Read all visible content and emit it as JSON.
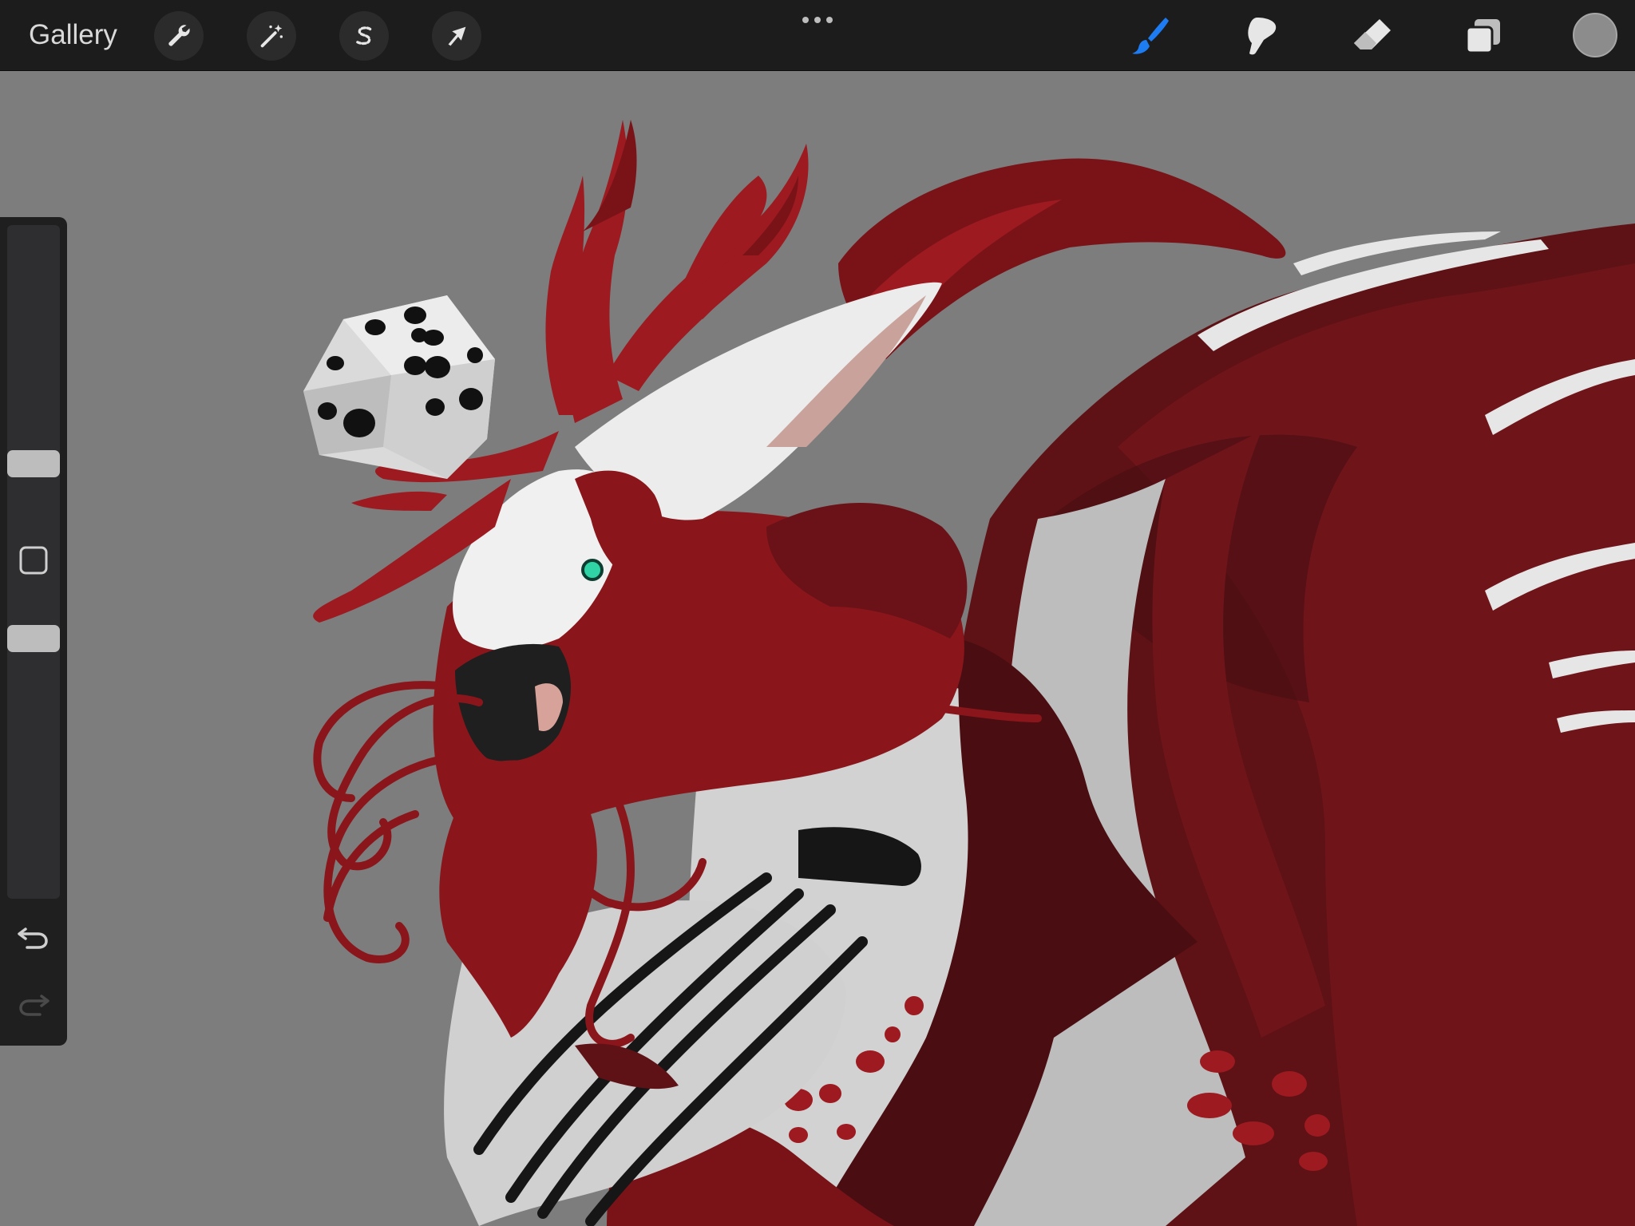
{
  "toolbar": {
    "gallery_label": "Gallery",
    "left_tools": [
      {
        "name": "actions",
        "icon": "wrench-icon"
      },
      {
        "name": "adjustments",
        "icon": "magic-wand-icon"
      },
      {
        "name": "selection",
        "icon": "selection-s-icon"
      },
      {
        "name": "transform",
        "icon": "arrow-cursor-icon"
      }
    ],
    "more_icon": "ellipsis-icon",
    "right_tools": [
      {
        "name": "brush",
        "icon": "brush-icon",
        "active": true
      },
      {
        "name": "smudge",
        "icon": "smudge-finger-icon",
        "active": false
      },
      {
        "name": "eraser",
        "icon": "eraser-icon",
        "active": false
      },
      {
        "name": "layers",
        "icon": "layers-icon",
        "active": false
      }
    ],
    "current_color": "#8c8c8c",
    "active_color": "#1e7cf2"
  },
  "sidebar": {
    "brush_size_level": 0.14,
    "opacity_level": 0.96,
    "modifier_icon": "square-modifier-icon",
    "undo_icon": "undo-icon",
    "redo_icon": "redo-icon"
  },
  "canvas": {
    "background": "#7d7d7d",
    "palette": {
      "red_main": "#9c1a20",
      "red_dark": "#5e1216",
      "red_deep": "#3f0c0f",
      "white": "#eeeeee",
      "light_gray": "#cfcfcf",
      "black": "#1a1a1a",
      "eye": "#2fd3a5"
    }
  }
}
